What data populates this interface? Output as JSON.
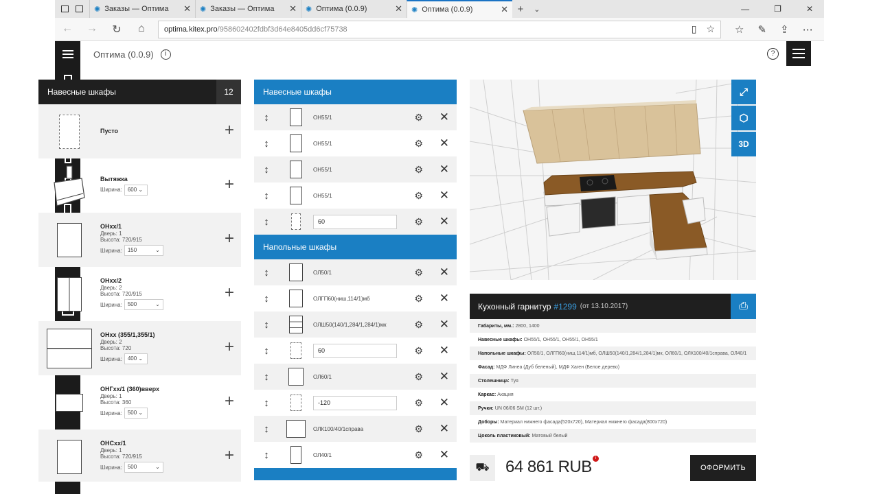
{
  "browser": {
    "tabs": [
      {
        "title": "Заказы — Оптима"
      },
      {
        "title": "Заказы — Оптима"
      },
      {
        "title": "Оптима (0.0.9)"
      },
      {
        "title": "Оптима (0.0.9)"
      }
    ],
    "url_host": "optima.kitex.pro",
    "url_path": "/958602402fdbf3d64e8405dd6cf75738"
  },
  "app": {
    "title": "Оптима (0.0.9)",
    "info_glyph": "i",
    "help_glyph": "?"
  },
  "library": {
    "title": "Навесные шкафы",
    "count": "12",
    "items": [
      {
        "name": "Пусто"
      },
      {
        "name": "Вытяжка",
        "width_label": "Ширина:",
        "width": "600"
      },
      {
        "name": "ОНхх/1",
        "line1": "Дверь: 1",
        "line2": "Высота: 720/915",
        "width_label": "Ширина:",
        "width": "150"
      },
      {
        "name": "ОНхх/2",
        "line1": "Дверь: 2",
        "line2": "Высота: 720/915",
        "width_label": "Ширина:",
        "width": "500"
      },
      {
        "name": "ОНхх (355/1,355/1)",
        "line1": "Дверь: 2",
        "line2": "Высота: 720",
        "width_label": "Ширина:",
        "width": "400"
      },
      {
        "name": "ОНГхх/1 (360)вверх",
        "line1": "Дверь: 1",
        "line2": "Высота: 360",
        "width_label": "Ширина:",
        "width": "500"
      },
      {
        "name": "ОНСхх/1",
        "line1": "Дверь: 1",
        "line2": "Высота: 720/915",
        "width_label": "Ширина:",
        "width": "500"
      }
    ]
  },
  "composition": {
    "wall_title": "Навесные шкафы",
    "wall_rows": [
      {
        "name": "ОН55/1"
      },
      {
        "name": "ОН55/1"
      },
      {
        "name": "ОН55/1"
      },
      {
        "name": "ОН55/1"
      },
      {
        "value": "60"
      }
    ],
    "floor_title": "Напольные шкафы",
    "floor_rows": [
      {
        "name": "ОЛ50/1"
      },
      {
        "name": "ОЛГП60(ниш,114/1)мб"
      },
      {
        "name": "ОЛШ50(140/1,284/1,284/1)мк"
      },
      {
        "value": "60"
      },
      {
        "name": "ОЛ60/1"
      },
      {
        "value": "-120"
      },
      {
        "name": "ОЛК100/40/1справа"
      },
      {
        "name": "ОЛ40/1"
      }
    ]
  },
  "viewer": {
    "btn_3d": "3D"
  },
  "spec": {
    "title": "Кухонный гарнитур",
    "number": "#1299",
    "date": "(от 13.10.2017)",
    "rows": [
      {
        "label": "Габариты, мм.:",
        "value": "2800, 1400"
      },
      {
        "label": "Навесные шкафы:",
        "value": "ОН55/1, ОН55/1, ОН55/1, ОН55/1"
      },
      {
        "label": "Напольные шкафы:",
        "value": "ОЛ50/1, ОЛГП60(ниш,114/1)мб, ОЛШ50(140/1,284/1,284/1)мк, ОЛ60/1, ОЛК100/40/1справа, ОЛ40/1"
      },
      {
        "label": "Фасад:",
        "value": "МДФ Линеа (Дуб беленый), МДФ Хаген (Белое дерево)"
      },
      {
        "label": "Столешница:",
        "value": "Туя"
      },
      {
        "label": "Каркас:",
        "value": "Акация"
      },
      {
        "label": "Ручки:",
        "value": "UN 06/06 SM (12 шт.)"
      },
      {
        "label": "Доборы:",
        "value": "Материал нижнего фасада(520х720), Материал нижнего фасада(800х720)"
      },
      {
        "label": "Цоколь пластиковый:",
        "value": "Матовый белый"
      }
    ]
  },
  "footer": {
    "price": "64 861 RUB",
    "badge": "i",
    "order_label": "ОФОРМИТЬ"
  },
  "colors": {
    "accent": "#1a7fc3",
    "dark": "#1f1f1f"
  }
}
